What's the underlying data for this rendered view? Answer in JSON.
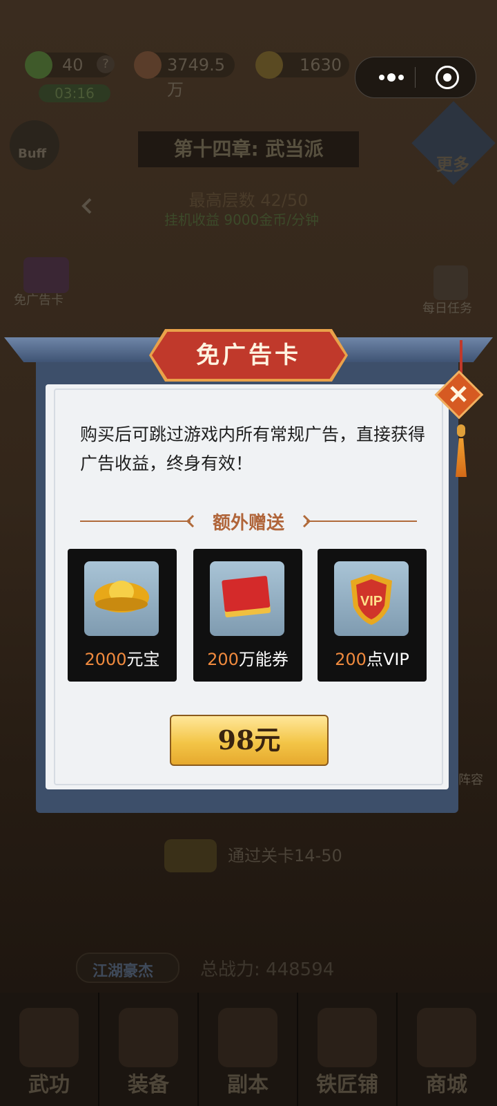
{
  "hud": {
    "stamina": "40",
    "help_mark": "?",
    "timer": "03:16",
    "coins": "3749.5万",
    "gold": "1630"
  },
  "left_buttons": {
    "buff_label": "Buff"
  },
  "chapter": {
    "title": "第十四章: 武当派",
    "max_floor": "最高层数 42/50",
    "idle_income": "挂机收益 9000金币/分钟"
  },
  "right_buttons": {
    "more_label": "更多",
    "daily_task_label": "每日任务",
    "lineup_label": "阵容"
  },
  "left_side_items": {
    "ad_free_card_label": "免广告卡"
  },
  "dialog": {
    "title": "免广告卡",
    "description": "购买后可跳过游戏内所有常规广告，直接获得广告收益，终身有效！",
    "bonus_header": "额外赠送",
    "rewards": [
      {
        "amount": "2000",
        "unit": "元宝",
        "icon": "gold-ingot-icon"
      },
      {
        "amount": "200",
        "unit": "万能券",
        "icon": "voucher-icon"
      },
      {
        "amount": "200",
        "unit": "点VIP",
        "icon": "vip-shield-icon"
      }
    ],
    "price": "98元"
  },
  "progress_chest": {
    "text": "通过关卡14-50"
  },
  "power": {
    "rank_label": "江湖豪杰",
    "total_power": "总战力:  448594"
  },
  "bottom_nav": [
    {
      "label": "武功"
    },
    {
      "label": "装备"
    },
    {
      "label": "副本"
    },
    {
      "label": "铁匠铺"
    },
    {
      "label": "商城"
    }
  ],
  "colors": {
    "dialog_frame": "#3d4f6a",
    "title_banner": "#c0392b",
    "price_button": "#f3c547",
    "reward_number": "#f08a3e"
  }
}
